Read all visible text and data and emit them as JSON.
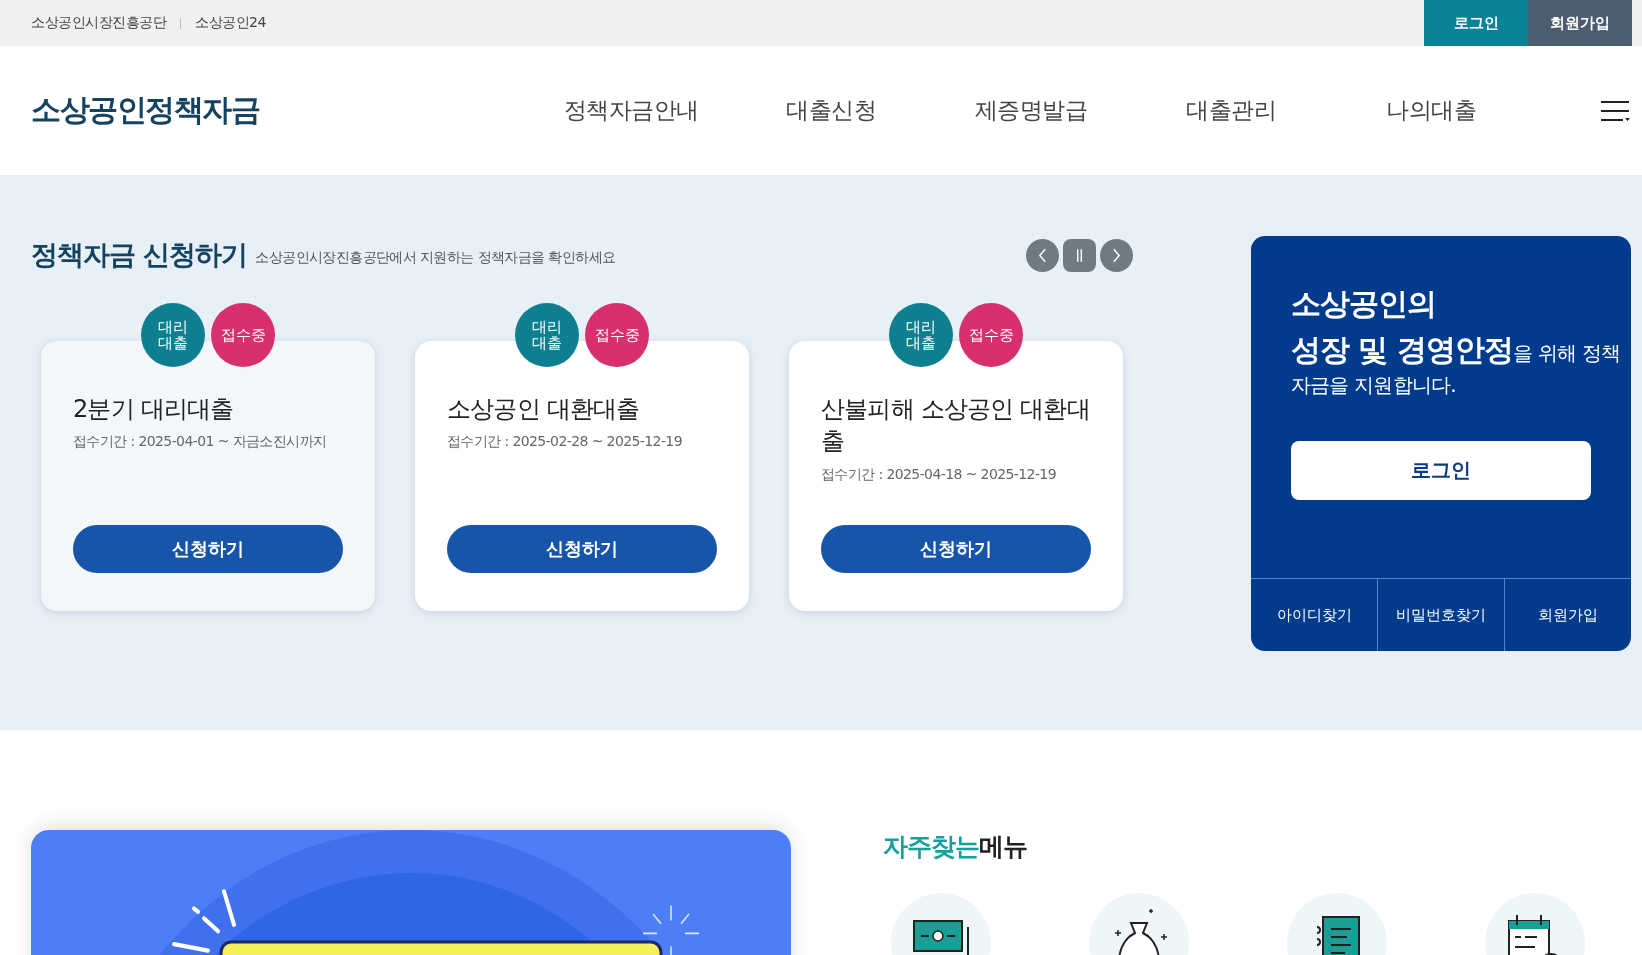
{
  "top_bar": {
    "links": [
      "소상공인시장진흥공단",
      "소상공인24"
    ],
    "buttons": [
      {
        "label": "로그인",
        "kind": "login"
      },
      {
        "label": "회원가입",
        "kind": "join"
      }
    ]
  },
  "header": {
    "logo": "소상공인정책자금",
    "nav": [
      "정책자금안내",
      "대출신청",
      "제증명발급",
      "대출관리",
      "나의대출"
    ]
  },
  "apply_section": {
    "title": "정책자금 신청하기",
    "subtitle": "소상공인시장진흥공단에서 지원하는 정책자금을 확인하세요",
    "cards": [
      {
        "type_tag": "대리 대출",
        "status_tag": "접수중",
        "title": "2분기 대리대출",
        "period": "접수기간 : 2025-04-01 ~ 자금소진시까지",
        "button": "신청하기",
        "selected": true
      },
      {
        "type_tag": "대리 대출",
        "status_tag": "접수중",
        "title": "소상공인 대환대출",
        "period": "접수기간 : 2025-02-28 ~ 2025-12-19",
        "button": "신청하기",
        "selected": false
      },
      {
        "type_tag": "대리 대출",
        "status_tag": "접수중",
        "title": "산불피해 소상공인 대환대출",
        "period": "접수기간 : 2025-04-18 ~ 2025-12-19",
        "button": "신청하기",
        "selected": false
      }
    ]
  },
  "login_panel": {
    "headline": "소상공인의",
    "message": "**성장 및 경영안정**을 위해 정책자금을 지원합니다.",
    "button": "로그인",
    "links": [
      "아이디찾기",
      "비밀번호찾기",
      "회원가입"
    ]
  },
  "quick_menu": {
    "title_accent": "자주찾는",
    "title": "메뉴",
    "items": [
      {
        "kind": "money"
      },
      {
        "kind": "bag"
      },
      {
        "kind": "document"
      },
      {
        "kind": "calendar"
      }
    ]
  }
}
